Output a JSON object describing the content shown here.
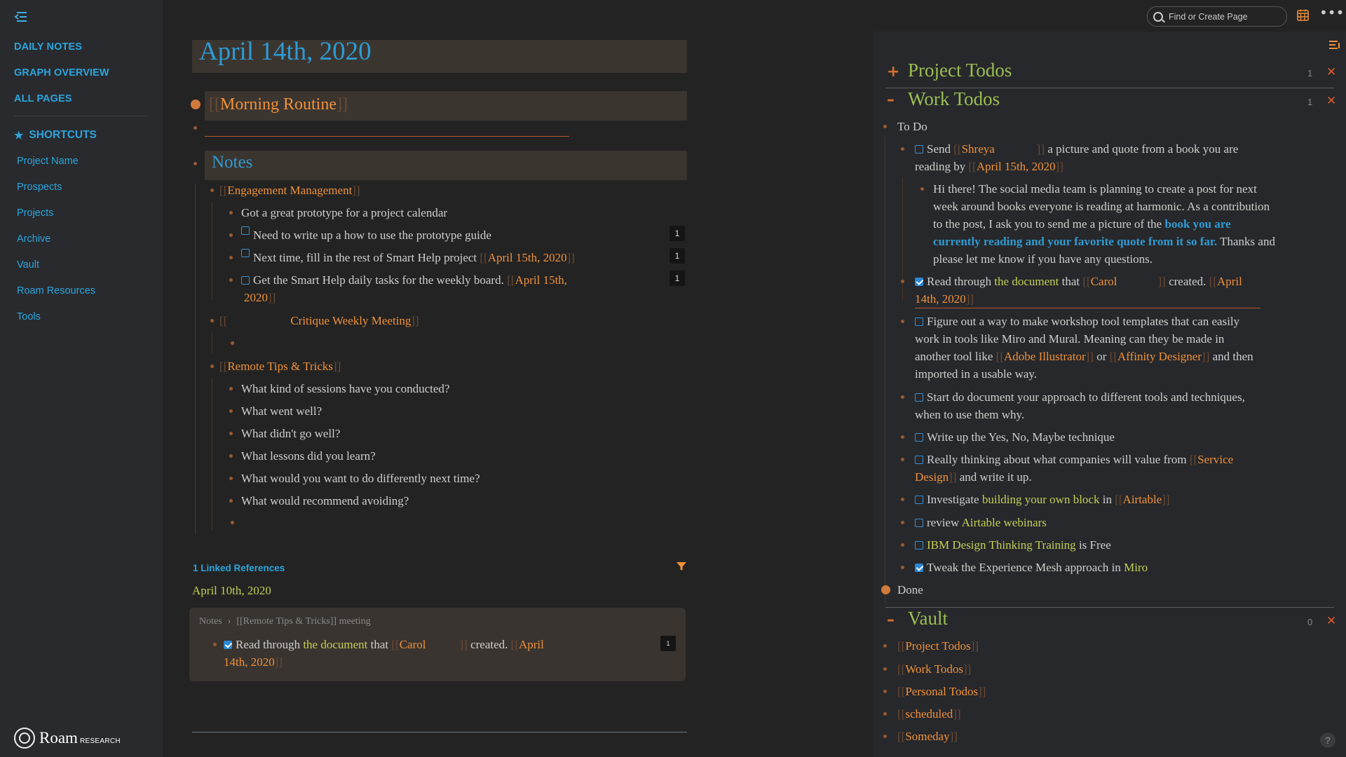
{
  "sidebar": {
    "nav": [
      "DAILY NOTES",
      "GRAPH OVERVIEW",
      "ALL PAGES"
    ],
    "shortcuts_title": "SHORTCUTS",
    "shortcuts": [
      "Project Name",
      "Prospects",
      "Projects",
      "Archive",
      "Vault",
      "Roam Resources",
      "Tools"
    ],
    "logo_word": "Roam",
    "logo_sub": "RESEARCH"
  },
  "topbar": {
    "search_placeholder": "Find or Create Page"
  },
  "page": {
    "title": "April 14th, 2020",
    "morning_routine": "Morning Routine",
    "notes_heading": "Notes",
    "engagement": "Engagement Management",
    "e1": "Got a great prototype for a project calendar",
    "e2": "Need to write up a how to use the prototype guide",
    "e3": "Next time, fill in the rest of Smart Help project",
    "e3_ref": "April 15th, 2020",
    "e4a": "Get the Smart Help daily tasks for the weekly board.",
    "e4_ref1": "April 15th,",
    "e4_ref2": "2020",
    "counts": [
      "1",
      "1",
      "1"
    ],
    "critique": "Critique Weekly Meeting",
    "remote": "Remote Tips & Tricks",
    "remote_items": [
      "What kind of sessions have you conducted?",
      "What went well?",
      "What didn't go well?",
      "What lessons did you learn?",
      "What would you want to do differently next time?",
      "What would recommend avoiding?"
    ]
  },
  "linked": {
    "heading": "1 Linked References",
    "date": "April 10th, 2020",
    "crumb1": "Notes",
    "crumb2": "[[Remote Tips & Tricks]] meeting",
    "t1": "Read through",
    "t_link": "the document",
    "t2": "that",
    "t_ref": "Carol",
    "t3": "created.",
    "t_date1": "April",
    "t_date2": "14th, 2020",
    "count": "1"
  },
  "right": {
    "project_todos": "Project Todos",
    "project_count": "1",
    "work_todos": "Work Todos",
    "work_count": "1",
    "to_do": "To Do",
    "done": "Done",
    "vault": "Vault",
    "vault_count": "0",
    "vault_items": [
      "Project Todos",
      "Work Todos",
      "Personal Todos",
      "scheduled",
      "Someday"
    ]
  },
  "work": {
    "w1a": "Send",
    "w1_ref": "Shreya",
    "w1b": "a picture and quote from a book you are",
    "w1c": "reading by",
    "w1_date": "April 15th, 2020",
    "msg1": "Hi there! The social media team is planning to create a post for next",
    "msg2": "week around books everyone is reading at harmonic. As a contribution",
    "msg3a": "to the post, I ask you to send me a picture of the",
    "msg3_link": "book you are",
    "msg4_link": "currently reading and your favorite quote from it so far.",
    "msg4b": "Thanks and",
    "msg5": "please let me know if you have any questions.",
    "w2a": "Read through",
    "w2_link": "the document",
    "w2b": "that",
    "w2_ref": "Carol",
    "w2c": "created.",
    "w2_date1": "April",
    "w2_date2": "14th, 2020",
    "w3a": "Figure out a way to make workshop tool templates that can easily",
    "w3b": "work in tools like Miro and Mural. Meaning can they be made in",
    "w3c": "another tool like",
    "w3_ref1": "Adobe Illustrator",
    "w3d": "or",
    "w3_ref2": "Affinity Designer",
    "w3e": "and then",
    "w3f": "imported in a usable way.",
    "w4a": "Start do document your approach to different tools and techniques,",
    "w4b": "when to use them why.",
    "w5": "Write up the Yes, No, Maybe technique",
    "w6a": "Really thinking about what companies will value from",
    "w6_ref1": "Service",
    "w6_ref2": "Design",
    "w6b": "and write it up.",
    "w7a": "Investigate",
    "w7_link": "building your own block",
    "w7b": "in",
    "w7_ref": "Airtable",
    "w8a": "review",
    "w8_link": "Airtable webinars",
    "w9_link": "IBM Design Thinking Training",
    "w9b": "is Free",
    "w10a": "Tweak the Experience Mesh approach in",
    "w10_link": "Miro"
  }
}
